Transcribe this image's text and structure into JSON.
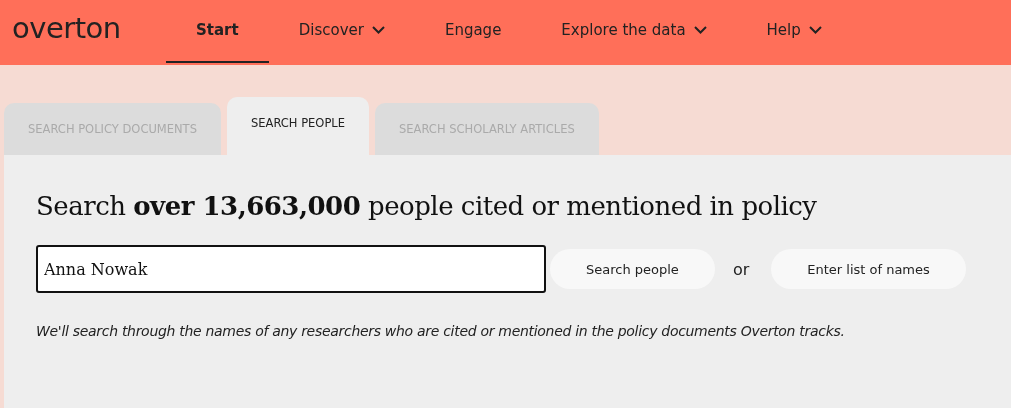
{
  "logo": "overton",
  "nav": [
    {
      "label": "Start",
      "selected": true,
      "dropdown": false
    },
    {
      "label": "Discover",
      "selected": false,
      "dropdown": true
    },
    {
      "label": "Engage",
      "selected": false,
      "dropdown": false
    },
    {
      "label": "Explore the data",
      "selected": false,
      "dropdown": true
    },
    {
      "label": "Help",
      "selected": false,
      "dropdown": true
    }
  ],
  "tabs": [
    {
      "label": "SEARCH POLICY DOCUMENTS",
      "selected": false
    },
    {
      "label": "SEARCH PEOPLE",
      "selected": true
    },
    {
      "label": "SEARCH SCHOLARLY ARTICLES",
      "selected": false
    }
  ],
  "heading": "Search **over 13,663,000** people cited or mentioned in policy",
  "search": {
    "value": "Anna Nowak"
  },
  "search_button": "Search people",
  "or": "or",
  "list_button": "Enter list of names",
  "note": "We'll search through the names of any researchers who are cited or mentioned in the policy documents Overton tracks."
}
